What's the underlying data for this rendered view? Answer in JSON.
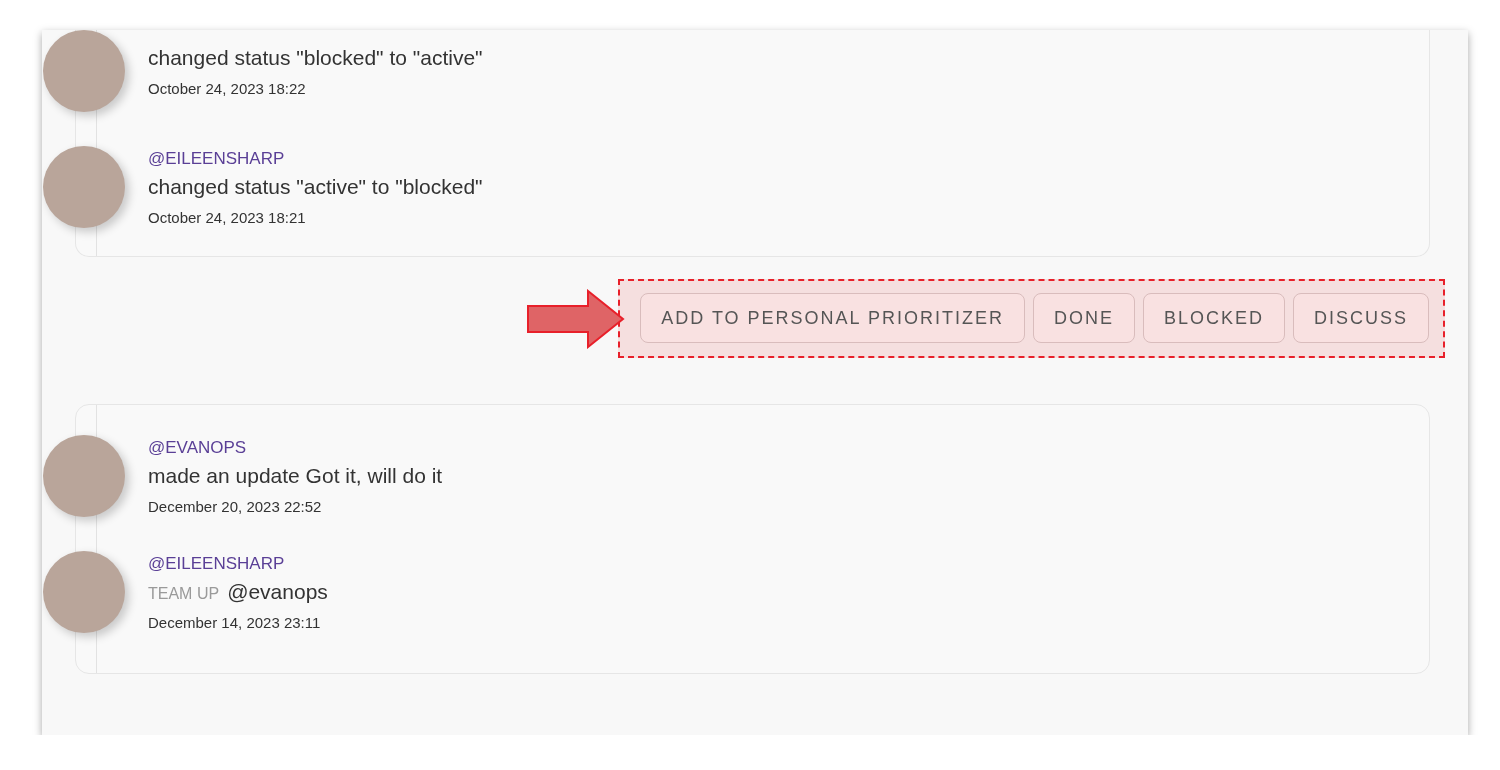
{
  "cards": [
    {
      "entries": [
        {
          "message": "changed status \"blocked\" to \"active\"",
          "timestamp": "October 24, 2023 18:22"
        },
        {
          "user": "@EILEENSHARP",
          "message": "changed status \"active\" to \"blocked\"",
          "timestamp": "October 24, 2023 18:21"
        }
      ]
    },
    {
      "entries": [
        {
          "user": "@EVANOPS",
          "message": "made an update Got it, will do it",
          "timestamp": "December 20, 2023 22:52"
        },
        {
          "user": "@EILEENSHARP",
          "tag": "TEAM UP",
          "message": "@evanops",
          "timestamp": "December 14, 2023 23:11"
        }
      ]
    }
  ],
  "actions": [
    "ADD TO PERSONAL PRIORITIZER",
    "DONE",
    "BLOCKED",
    "DISCUSS"
  ]
}
